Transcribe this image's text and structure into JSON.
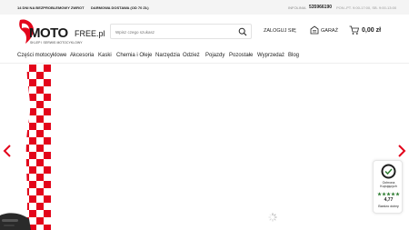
{
  "topbar": {
    "returns": "14 DNI NA BEZPROBLEMOWY ZWROT",
    "shipping": "DARMOWA DOSTAWA (OD 70 ZŁ)",
    "hotline_label": "INFOLINIA",
    "phone": "535966190",
    "hours": "PON.-PT. 9:00-17:00, SB. 9:00-13:00"
  },
  "logo": {
    "moto": "MOTO",
    "free": "FREE.pl",
    "tagline": "SKLEP I SERWIS MOTOCYKLOWY"
  },
  "search": {
    "placeholder": "Wpisz czego szukasz"
  },
  "account": {
    "login": "ZALOGUJ SIĘ",
    "garage": "GARAŻ",
    "cart_total": "0,00 zł"
  },
  "nav": {
    "items": [
      "Części motocyklowe",
      "Akcesoria",
      "Kaski",
      "Chemia i Oleje",
      "Narzędzia",
      "Odzież",
      "Pojazdy",
      "Pozostałe",
      "Wyprzedaż",
      "Blog"
    ]
  },
  "badge": {
    "title": "Ochrona Kupujących",
    "score": "4,77",
    "rating_label": "Bardzo dobry",
    "stars": 5
  },
  "colors": {
    "brand_red": "#e3051b",
    "arrow_red": "#e3051b",
    "badge_green": "#2e7d32"
  }
}
